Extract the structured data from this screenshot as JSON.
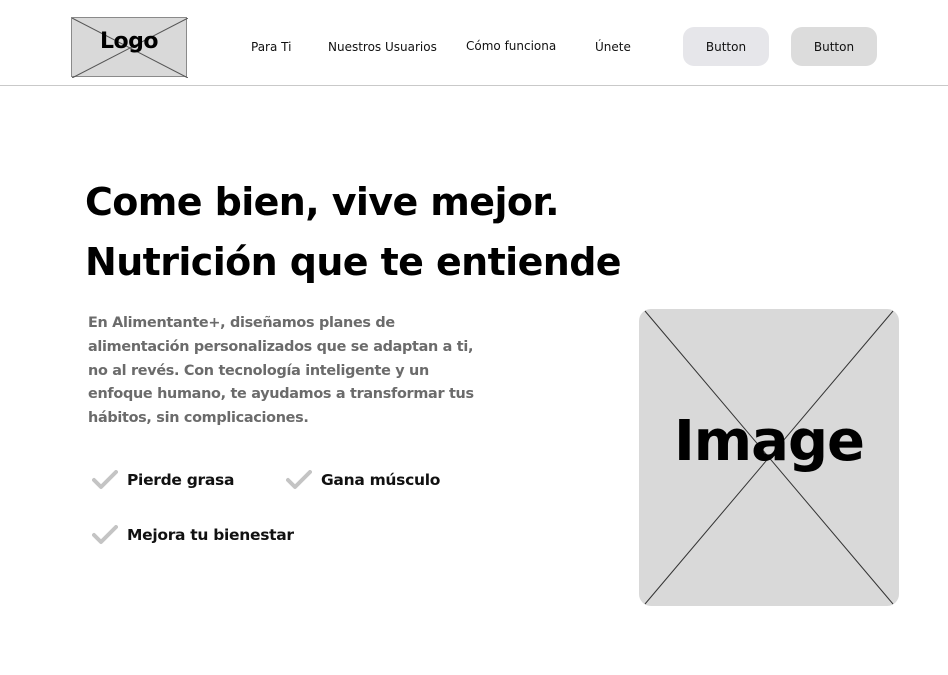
{
  "header": {
    "logo_text": "Logo",
    "nav": [
      "Para Ti",
      "Nuestros Usuarios",
      "Cómo funciona",
      "Únete"
    ],
    "button1_label": "Button",
    "button2_label": "Button"
  },
  "hero": {
    "headline_line1": "Come bien, vive mejor.",
    "headline_line2": "Nutrición que te entiende",
    "description": "En Alimentante+, diseñamos planes de alimentación personalizados que se adaptan a ti, no al revés. Con tecnología inteligente y un enfoque humano, te ayudamos a transformar tus hábitos, sin complicaciones.",
    "features": [
      "Pierde grasa",
      "Gana músculo",
      "Mejora tu bienestar"
    ],
    "image_text": "Image"
  },
  "colors": {
    "placeholder_gray": "#d9d9d9",
    "check_gray": "#c4c4c4",
    "body_text_gray": "#6b6b6b"
  }
}
